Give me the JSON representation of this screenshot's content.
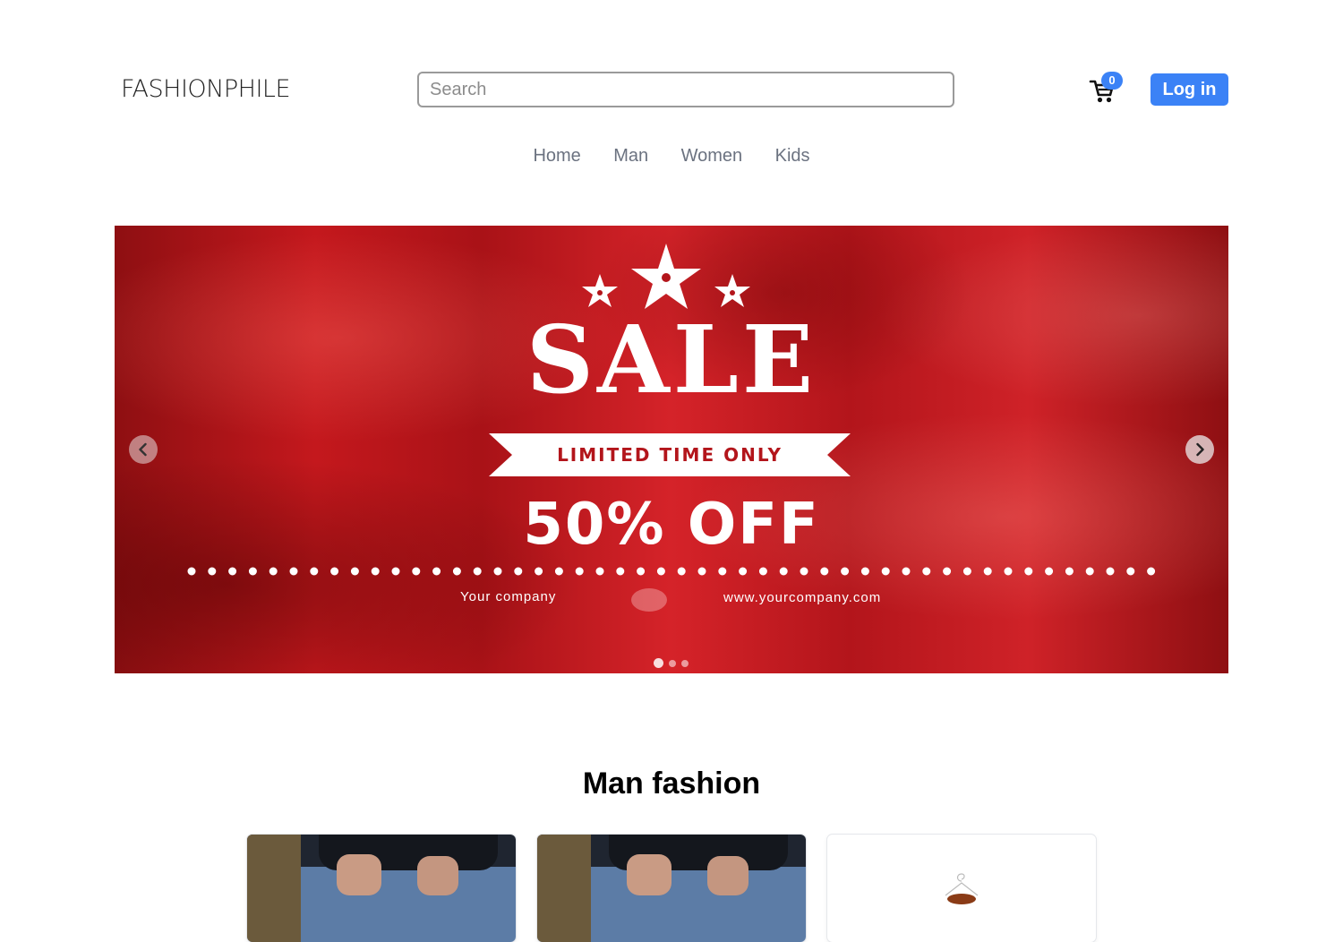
{
  "header": {
    "logo": "FASHIONPHILE",
    "search_placeholder": "Search",
    "cart_count": "0",
    "login_label": "Log in",
    "accent_color": "#3b82f6"
  },
  "nav": {
    "items": [
      {
        "label": "Home"
      },
      {
        "label": "Man"
      },
      {
        "label": "Women"
      },
      {
        "label": "Kids"
      }
    ]
  },
  "carousel": {
    "slide": {
      "headline": "SALE",
      "ribbon": "LIMITED TIME ONLY",
      "offer": "50% OFF",
      "company": "Your company",
      "website": "www.yourcompany.com"
    },
    "slide_count": 3,
    "active_slide": 1,
    "prev_icon": "chevron-left-icon",
    "next_icon": "chevron-right-icon"
  },
  "section": {
    "title": "Man fashion"
  }
}
